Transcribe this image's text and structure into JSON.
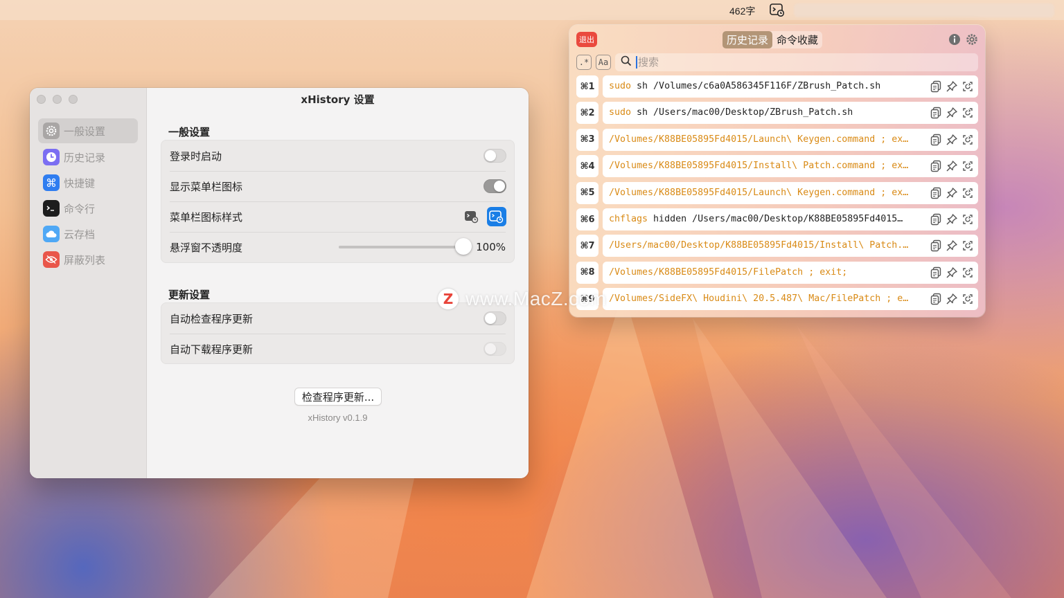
{
  "menubar": {
    "word_count": "462字",
    "app_icon": "history-terminal-icon"
  },
  "settings_window": {
    "title": "xHistory 设置",
    "sidebar": [
      {
        "label": "一般设置",
        "icon": "gear-icon",
        "active": true
      },
      {
        "label": "历史记录",
        "icon": "clock-icon"
      },
      {
        "label": "快捷键",
        "icon": "command-key-icon"
      },
      {
        "label": "命令行",
        "icon": "terminal-icon"
      },
      {
        "label": "云存档",
        "icon": "cloud-icon"
      },
      {
        "label": "屏蔽列表",
        "icon": "eye-slash-icon"
      }
    ],
    "general": {
      "title": "一般设置",
      "launch_at_login": {
        "label": "登录时启动",
        "on": false
      },
      "show_menubar_icon": {
        "label": "显示菜单栏图标",
        "on": true
      },
      "menubar_icon_style": {
        "label": "菜单栏图标样式"
      },
      "opacity": {
        "label": "悬浮窗不透明度",
        "value": "100%",
        "fraction": 1.0
      }
    },
    "update": {
      "title": "更新设置",
      "auto_check": {
        "label": "自动检查程序更新",
        "on": false
      },
      "auto_download": {
        "label": "自动下载程序更新",
        "on": false
      }
    },
    "check_button": "检查程序更新...",
    "version": "xHistory v0.1.9"
  },
  "history_panel": {
    "exit_label": "退出",
    "tabs": [
      {
        "label": "历史记录",
        "selected": true
      },
      {
        "label": "命令收藏",
        "selected": false
      }
    ],
    "regex_label": ".*",
    "case_label": "Aa",
    "search_placeholder": "搜索",
    "rows": [
      {
        "key": "⌘1",
        "kw": "sudo",
        "rest": " sh /Volumes/c6a0A586345F116F/ZBrush_Patch.sh"
      },
      {
        "key": "⌘2",
        "kw": "sudo",
        "rest": " sh /Users/mac00/Desktop/ZBrush_Patch.sh"
      },
      {
        "key": "⌘3",
        "kw": "/Volumes/K88BE05895Fd4015/Launch\\ Keygen.command ; ex…",
        "rest": ""
      },
      {
        "key": "⌘4",
        "kw": "/Volumes/K88BE05895Fd4015/Install\\ Patch.command ; ex…",
        "rest": ""
      },
      {
        "key": "⌘5",
        "kw": "/Volumes/K88BE05895Fd4015/Launch\\ Keygen.command ; ex…",
        "rest": ""
      },
      {
        "key": "⌘6",
        "kw": "chflags",
        "rest": " hidden  /Users/mac00/Desktop/K88BE05895Fd4015…"
      },
      {
        "key": "⌘7",
        "kw": "/Users/mac00/Desktop/K88BE05895Fd4015/Install\\ Patch.…",
        "rest": ""
      },
      {
        "key": "⌘8",
        "kw": "/Volumes/K88BE05895Fd4015/FilePatch ; exit;",
        "rest": ""
      },
      {
        "key": "⌘9",
        "kw": "/Volumes/SideFX\\ Houdini\\ 20.5.487\\ Mac/FilePatch ; e…",
        "rest": ""
      }
    ]
  },
  "watermark": {
    "logo": "Z",
    "text": "www.MacZ.com"
  },
  "colors": {
    "accent_blue": "#1a7ee6",
    "exit_red": "#ea4a3e",
    "command_orange": "#d98a15",
    "tab_selected": "#b39577"
  }
}
